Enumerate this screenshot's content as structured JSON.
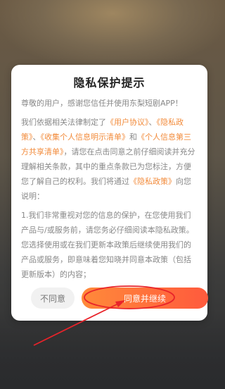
{
  "dialog": {
    "title": "隐私保护提示",
    "greeting": "尊敬的用户，感谢您信任并使用东梨短剧APP！",
    "para2": {
      "t1": "我们依据相关法律制定了",
      "l1": "《用户协议》",
      "t2": "、",
      "l2": "《隐私政策》",
      "t3": "、",
      "l3": "《收集个人信息明示清单》",
      "t4": "和",
      "l4": "《个人信息第三方共享清单》",
      "t5": "，请您在点击同意之前仔细阅读并充分理解相关条款，其中的重点条款已为您标注，方便您了解自己的权利。我们将通过",
      "l5": "《隐私政策》",
      "t6": "向您说明："
    },
    "para3": "1.我们非常重视对您的信息的保护，在您使用我们产品与/或服务前，请您务必仔细阅读本隐私政策。您选择使用或在我们更新本政策后继续使用我们的产品或服务，即意味着您知晓并同意本政策（包括更新版本）的内容；",
    "disagree_label": "不同意",
    "agree_label": "同意并继续"
  },
  "colors": {
    "accent": "#f28b3b",
    "button_gradient_start": "#ff8a3a",
    "button_gradient_end": "#ff5a3d",
    "annotation": "#e8232a"
  }
}
